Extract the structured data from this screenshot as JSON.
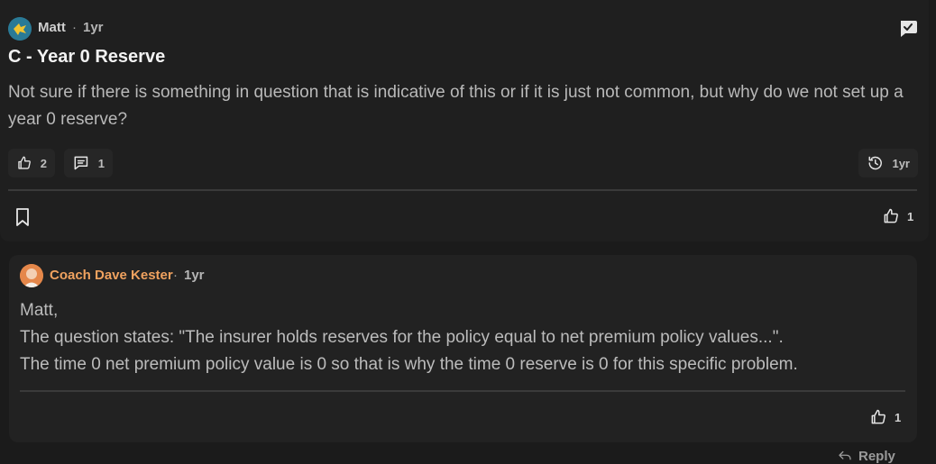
{
  "post": {
    "author": "Matt",
    "separator": "·",
    "time": "1yr",
    "title": "C - Year 0 Reserve",
    "body": "Not sure if there is something in question that is indicative of this or if it is just not common, but why do we not set up a year 0 reserve?",
    "likes_count": "2",
    "comments_count": "1",
    "history_time": "1yr",
    "footer_likes": "1",
    "icons": {
      "avatar": "avatar-image",
      "chat": "chat-check-icon",
      "like": "thumbs-up-icon",
      "comment": "comment-icon",
      "history": "history-clock-icon",
      "bookmark": "bookmark-icon"
    }
  },
  "reply": {
    "author": "Coach Dave Kester",
    "separator": "·",
    "time": "1yr",
    "lines": [
      "Matt,",
      "The question states: \"The insurer holds reserves for the policy equal to net premium policy values...\".",
      "The time 0 net premium policy value is 0 so that is why the time 0 reserve is 0 for this specific problem."
    ],
    "likes": "1",
    "reply_label": "Reply"
  },
  "colors": {
    "background": "#1b1b1b",
    "card": "#222222",
    "coach_name": "#f0a25f",
    "text": "#b9b9b9"
  }
}
